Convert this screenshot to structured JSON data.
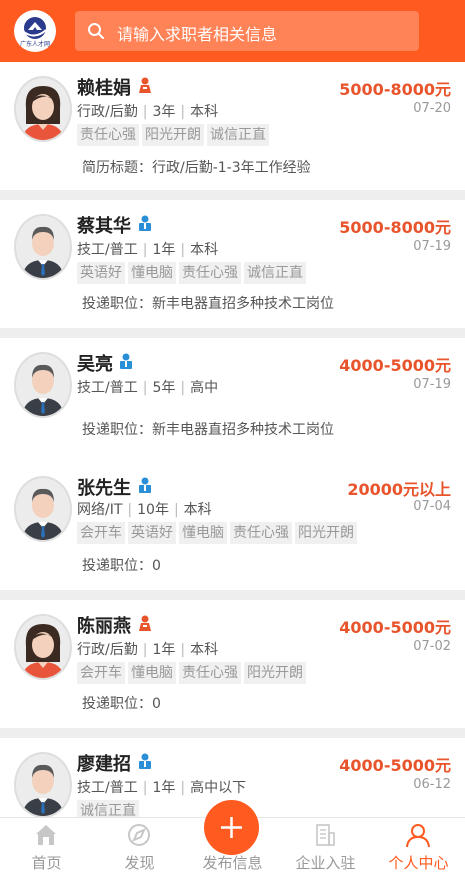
{
  "header": {
    "logo_text": "广东人才网",
    "search_placeholder": "请输入求职者相关信息"
  },
  "candidates": [
    {
      "name": "赖桂娟",
      "gender": "female",
      "category": "行政/后勤",
      "experience": "3年",
      "education": "本科",
      "salary": "5000-8000元",
      "date": "07-20",
      "tags": [
        "责任心强",
        "阳光开朗",
        "诚信正直"
      ],
      "info": "简历标题：行政/后勤-1-3年工作经验"
    },
    {
      "name": "蔡其华",
      "gender": "male",
      "category": "技工/普工",
      "experience": "1年",
      "education": "本科",
      "salary": "5000-8000元",
      "date": "07-19",
      "tags": [
        "英语好",
        "懂电脑",
        "责任心强",
        "诚信正直"
      ],
      "info": "投递职位：新丰电器直招多种技术工岗位"
    },
    {
      "name": "吴亮",
      "gender": "male",
      "category": "技工/普工",
      "experience": "5年",
      "education": "高中",
      "salary": "4000-5000元",
      "date": "07-19",
      "tags": [],
      "info": "投递职位：新丰电器直招多种技术工岗位"
    },
    {
      "name": "张先生",
      "gender": "male",
      "category": "网络/IT",
      "experience": "10年",
      "education": "本科",
      "salary": "20000元以上",
      "date": "07-04",
      "tags": [
        "会开车",
        "英语好",
        "懂电脑",
        "责任心强",
        "阳光开朗"
      ],
      "info": "投递职位：0"
    },
    {
      "name": "陈丽燕",
      "gender": "female",
      "category": "行政/后勤",
      "experience": "1年",
      "education": "本科",
      "salary": "4000-5000元",
      "date": "07-02",
      "tags": [
        "会开车",
        "懂电脑",
        "责任心强",
        "阳光开朗"
      ],
      "info": "投递职位：0"
    },
    {
      "name": "廖建招",
      "gender": "male",
      "category": "技工/普工",
      "experience": "1年",
      "education": "高中以下",
      "salary": "4000-5000元",
      "date": "06-12",
      "tags": [
        "诚信正直"
      ],
      "info": ""
    }
  ],
  "tabbar": {
    "home": "首页",
    "discover": "发现",
    "publish": "发布信息",
    "enterprise": "企业入驻",
    "profile": "个人中心"
  },
  "colors": {
    "brand": "#ff5a1f",
    "salary": "#e8542b",
    "female": "#e8542b",
    "male": "#2a8fd6"
  }
}
